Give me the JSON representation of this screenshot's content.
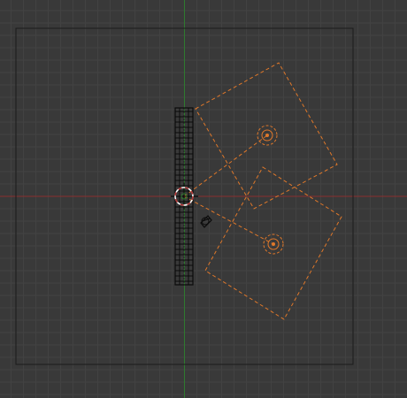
{
  "viewport": {
    "view": "camera-view",
    "background_color": "#393939",
    "grid_color": "#424242",
    "x_axis_color": "#8a3030",
    "y_axis_color": "#2f7a2f",
    "frame_color": "#1a1a1a"
  },
  "objects": [
    {
      "kind": "mesh-object",
      "icon": "lattice-mesh-icon",
      "state": "unselected",
      "color": "#0b0b0b"
    },
    {
      "kind": "spot-lamp",
      "icon": "lamp-icon",
      "state": "selected",
      "color": "#e0782a"
    },
    {
      "kind": "spot-lamp",
      "icon": "lamp-icon",
      "state": "selected",
      "color": "#e0782a"
    },
    {
      "kind": "speaker-object",
      "icon": "speaker-icon",
      "state": "unselected",
      "color": "#0b0b0b"
    }
  ],
  "cursor": {
    "icon": "3d-cursor-icon",
    "ring_colors": [
      "#b23030",
      "#ffffff"
    ]
  }
}
